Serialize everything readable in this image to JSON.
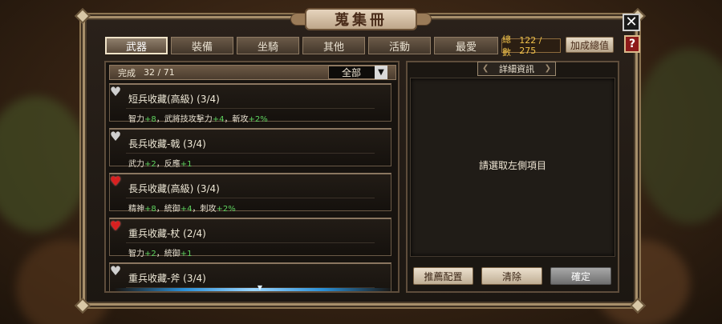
{
  "title": "蒐集冊",
  "window_controls": {
    "close_glyph": "✕",
    "help_glyph": "?"
  },
  "tabs": [
    {
      "label": "武器",
      "active": true
    },
    {
      "label": "裝備",
      "active": false
    },
    {
      "label": "坐騎",
      "active": false
    },
    {
      "label": "其他",
      "active": false
    },
    {
      "label": "活動",
      "active": false
    },
    {
      "label": "最愛",
      "active": false
    }
  ],
  "total": {
    "label": "總數",
    "value": "122 / 275"
  },
  "total_bonus_button": "加成總值",
  "filter": {
    "complete_label": "完成",
    "complete_value": "32 / 71",
    "dropdown_value": "全部",
    "dropdown_arrow": "▼"
  },
  "items": [
    {
      "name": "短兵收藏(高級) (3/4)",
      "favorite": false,
      "stats": [
        {
          "text": "智力",
          "bonus": "+8"
        },
        {
          "text": "，武將技攻擊力",
          "bonus": "+4"
        },
        {
          "text": "，斬攻",
          "bonus": "+2%"
        }
      ]
    },
    {
      "name": "長兵收藏-戟 (3/4)",
      "favorite": false,
      "stats": [
        {
          "text": "武力",
          "bonus": "+2"
        },
        {
          "text": "，反應",
          "bonus": "+1"
        }
      ]
    },
    {
      "name": "長兵收藏(高級) (3/4)",
      "favorite": true,
      "stats": [
        {
          "text": "精神",
          "bonus": "+8"
        },
        {
          "text": "，統御",
          "bonus": "+4"
        },
        {
          "text": "，刺攻",
          "bonus": "+2%"
        }
      ]
    },
    {
      "name": "重兵收藏-杖 (2/4)",
      "favorite": true,
      "stats": [
        {
          "text": "智力",
          "bonus": "+2"
        },
        {
          "text": "，統御",
          "bonus": "+1"
        }
      ]
    },
    {
      "name": "重兵收藏-斧 (3/4)",
      "favorite": false,
      "stats": []
    }
  ],
  "detail": {
    "tab_label": "詳細資訊",
    "placeholder": "請選取左側項目"
  },
  "buttons": {
    "recommend": "推薦配置",
    "clear": "清除",
    "confirm": "確定"
  },
  "colors": {
    "bonus_green": "#5fd35f",
    "favorite_red": "#d92020",
    "total_gold": "#f0c24a"
  },
  "icons": {
    "favorite": "heart-icon",
    "dropdown": "triangle-down-icon",
    "close": "close-icon",
    "help": "help-icon"
  }
}
